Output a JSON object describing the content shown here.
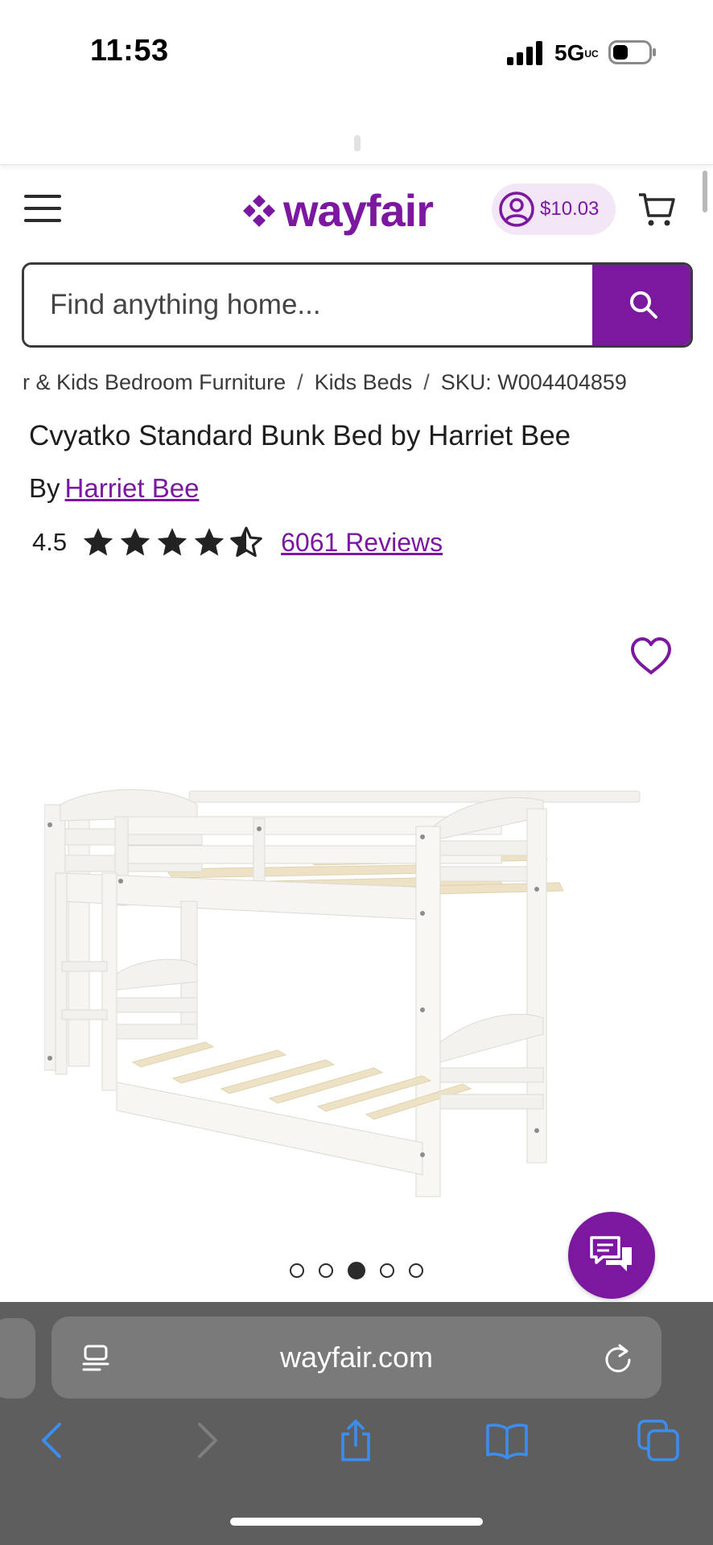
{
  "status_bar": {
    "time": "11:53",
    "network": "5G",
    "network_sub": "UC"
  },
  "header": {
    "logo_text": "wayfair",
    "rewards_amount": "$10.03"
  },
  "search": {
    "placeholder": "Find anything home..."
  },
  "breadcrumb": {
    "items": [
      "r & Kids Bedroom Furniture",
      "Kids Beds"
    ],
    "separator": "/",
    "sku": "SKU: W004404859"
  },
  "product": {
    "title": "Cvyatko Standard Bunk Bed by Harriet Bee",
    "by_prefix": "By",
    "brand": "Harriet Bee",
    "rating": "4.5",
    "stars_filled": 4.5,
    "stars_total": 5,
    "reviews_link": "6061 Reviews"
  },
  "carousel": {
    "total": 5,
    "active_index": 2
  },
  "safari": {
    "url": "wayfair.com"
  },
  "colors": {
    "brand_purple": "#7b189f",
    "safari_blue": "#3b8ef0"
  }
}
